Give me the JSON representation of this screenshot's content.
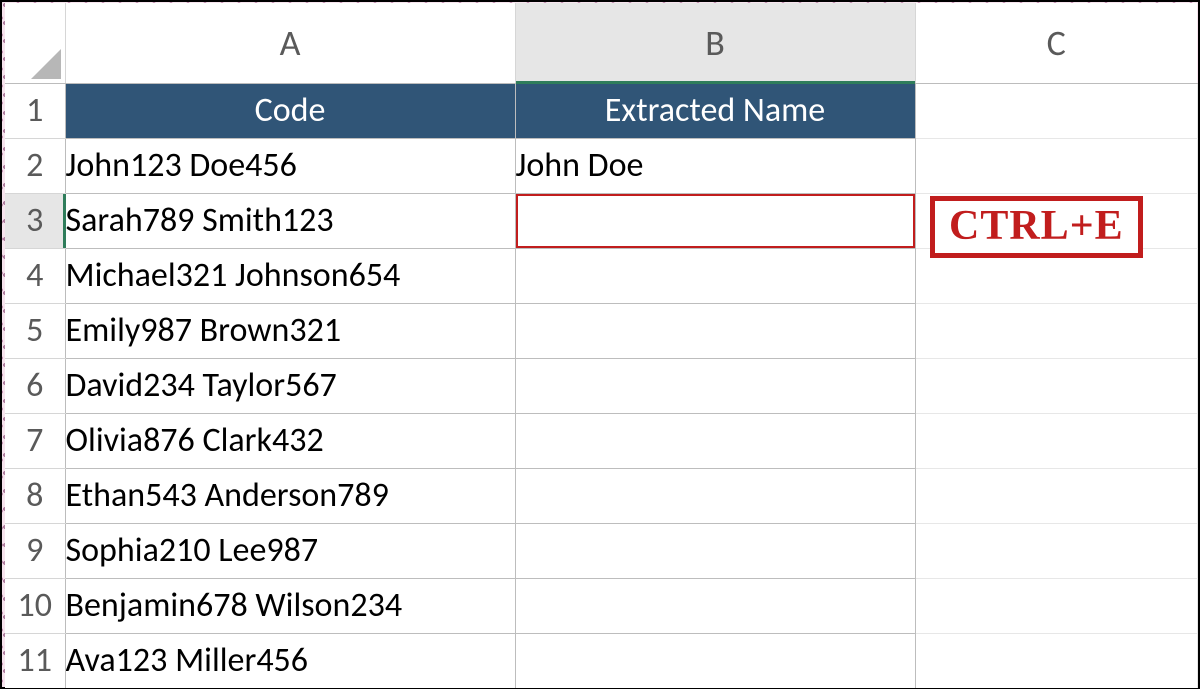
{
  "columns": {
    "A": "A",
    "B": "B",
    "C": "C"
  },
  "row_numbers": [
    "1",
    "2",
    "3",
    "4",
    "5",
    "6",
    "7",
    "8",
    "9",
    "10",
    "11"
  ],
  "headers": {
    "A": "Code",
    "B": "Extracted Name"
  },
  "rows": [
    {
      "code": "John123 Doe456",
      "extracted": "John Doe"
    },
    {
      "code": "Sarah789 Smith123",
      "extracted": ""
    },
    {
      "code": "Michael321 Johnson654",
      "extracted": ""
    },
    {
      "code": "Emily987 Brown321",
      "extracted": ""
    },
    {
      "code": "David234 Taylor567",
      "extracted": ""
    },
    {
      "code": "Olivia876 Clark432",
      "extracted": ""
    },
    {
      "code": "Ethan543 Anderson789",
      "extracted": ""
    },
    {
      "code": "Sophia210 Lee987",
      "extracted": ""
    },
    {
      "code": "Benjamin678 Wilson234",
      "extracted": ""
    },
    {
      "code": "Ava123 Miller456",
      "extracted": ""
    }
  ],
  "active_cell": {
    "col": "B",
    "row": 3
  },
  "hint": "CTRL+E",
  "colors": {
    "header_fill": "#305577",
    "selection": "#c11d1d",
    "col_active": "#e6e6e6"
  }
}
